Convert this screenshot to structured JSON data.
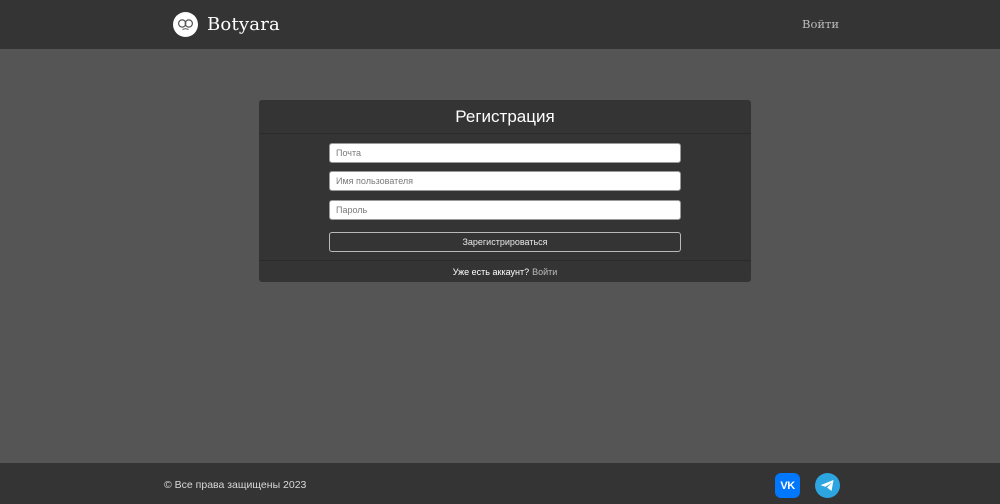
{
  "header": {
    "brand_name": "Botyara",
    "login_link": "Войти"
  },
  "form": {
    "title": "Регистрация",
    "email_placeholder": "Почта",
    "username_placeholder": "Имя пользователя",
    "password_placeholder": "Пароль",
    "submit_label": "Зарегистрироваться",
    "footer_question": "Уже есть аккаунт?",
    "footer_link": "Войти"
  },
  "footer": {
    "copyright": "© Все права защищены 2023",
    "social_vk_text": "VK",
    "social_vk_icon": "vk-icon",
    "social_telegram_icon": "telegram-icon"
  },
  "colors": {
    "page_bg": "#555555",
    "bar_bg": "#343434",
    "vk_blue": "#0077ff",
    "telegram_blue": "#2ca5e0"
  }
}
